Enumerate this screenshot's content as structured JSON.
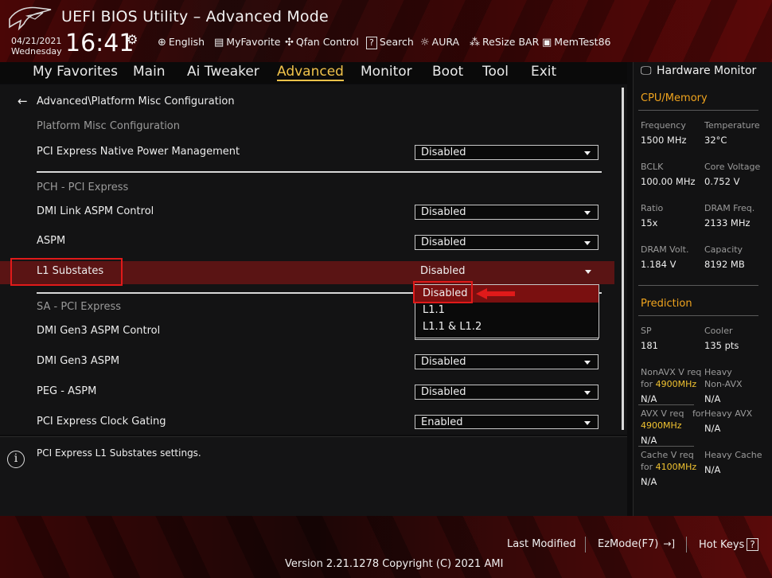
{
  "header": {
    "title": "UEFI BIOS Utility – Advanced Mode",
    "date": "04/21/2021",
    "weekday": "Wednesday",
    "time": "16:41",
    "tools": [
      {
        "icon": "globe-icon",
        "label": "English"
      },
      {
        "icon": "favorite-icon",
        "label": "MyFavorite"
      },
      {
        "icon": "fan-icon",
        "label": "Qfan Control"
      },
      {
        "icon": "help-icon",
        "label": "Search"
      },
      {
        "icon": "aura-icon",
        "label": "AURA"
      },
      {
        "icon": "resize-bar-icon",
        "label": "ReSize BAR"
      },
      {
        "icon": "memtest-icon",
        "label": "MemTest86"
      }
    ]
  },
  "nav": {
    "tabs": [
      "My Favorites",
      "Main",
      "Ai Tweaker",
      "Advanced",
      "Monitor",
      "Boot",
      "Tool",
      "Exit"
    ],
    "active": "Advanced"
  },
  "main": {
    "breadcrumb": "Advanced\\Platform Misc Configuration",
    "sections": {
      "platform": "Platform Misc Configuration",
      "pch": "PCH - PCI Express",
      "sa": "SA - PCI Express"
    },
    "settings": [
      {
        "label": "PCI Express Native Power Management",
        "value": "Disabled"
      },
      {
        "label": "DMI Link ASPM Control",
        "value": "Disabled"
      },
      {
        "label": "ASPM",
        "value": "Disabled"
      },
      {
        "label": "L1 Substates",
        "value": "Disabled"
      },
      {
        "label": "DMI Gen3 ASPM Control",
        "value": ""
      },
      {
        "label": "DMI Gen3 ASPM",
        "value": "Disabled"
      },
      {
        "label": "PEG - ASPM",
        "value": "Disabled"
      },
      {
        "label": "PCI Express Clock Gating",
        "value": "Enabled"
      }
    ],
    "dropdown_options": [
      "Disabled",
      "L1.1",
      "L1.1 & L1.2"
    ],
    "info_text": "PCI Express L1 Substates settings."
  },
  "hw": {
    "title": "Hardware Monitor",
    "cpu_section": "CPU/Memory",
    "cpu": [
      {
        "k1": "Frequency",
        "v1": "1500 MHz",
        "k2": "Temperature",
        "v2": "32°C"
      },
      {
        "k1": "BCLK",
        "v1": "100.00 MHz",
        "k2": "Core Voltage",
        "v2": "0.752 V"
      },
      {
        "k1": "Ratio",
        "v1": "15x",
        "k2": "DRAM Freq.",
        "v2": "2133 MHz"
      },
      {
        "k1": "DRAM Volt.",
        "v1": "1.184 V",
        "k2": "Capacity",
        "v2": "8192 MB"
      }
    ],
    "prediction_section": "Prediction",
    "sp_label": "SP",
    "sp_value": "181",
    "cooler_label": "Cooler",
    "cooler_value": "135 pts",
    "nonavx_label": "NonAVX V req",
    "for": "for",
    "nonavx_freq": "4900MHz",
    "nonavx_value": "N/A",
    "heavy_label": "Heavy",
    "heavy_nonavx_label": "Non-AVX",
    "heavy_nonavx_value": "N/A",
    "avx_label": "AVX V req",
    "avx_freq": "4900MHz",
    "avx_value": "N/A",
    "heavy_avx_label": "Heavy AVX",
    "heavy_avx_value": "N/A",
    "cache_label": "Cache V req",
    "cache_freq": "4100MHz",
    "cache_value": "N/A",
    "heavy_cache_label": "Heavy Cache",
    "heavy_cache_value": "N/A"
  },
  "footer": {
    "last_modified": "Last Modified",
    "ezmode": "EzMode(F7)",
    "ezmode_icon": "→]",
    "hotkeys": "Hot Keys",
    "hotkeys_icon": "?",
    "version": "Version 2.21.1278 Copyright (C) 2021 AMI"
  },
  "colors": {
    "accent": "#f0c24a",
    "highlight": "#5a1414",
    "annotation": "#e01a1a",
    "hw_section": "#f0a41e"
  }
}
